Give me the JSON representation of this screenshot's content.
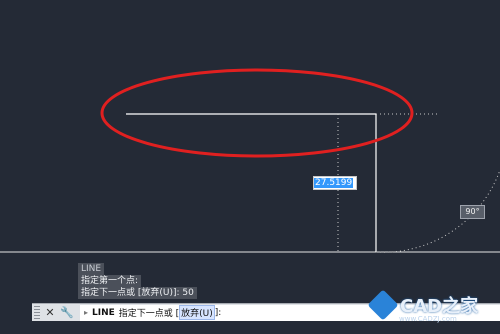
{
  "dimension_input": {
    "value": "27.5199"
  },
  "angle_tooltip": {
    "value": "90°"
  },
  "command_history": [
    "LINE",
    "指定第一个点:",
    "指定下一点或 [放弃(U)]: 50"
  ],
  "command_line": {
    "command": "LINE",
    "prompt": "指定下一点或 [",
    "keyword": "放弃(U)",
    "suffix": "]:"
  },
  "icons": {
    "close": "close-icon",
    "customize": "wrench-icon",
    "prompt": "command-prompt-icon"
  },
  "watermark": {
    "text": "CAD之家",
    "url": "www.CADZJ.com"
  },
  "colors": {
    "background": "#242a36",
    "line": "#ffffff",
    "annotation_circle": "#e02020",
    "dimension_highlight": "#3398fc"
  }
}
